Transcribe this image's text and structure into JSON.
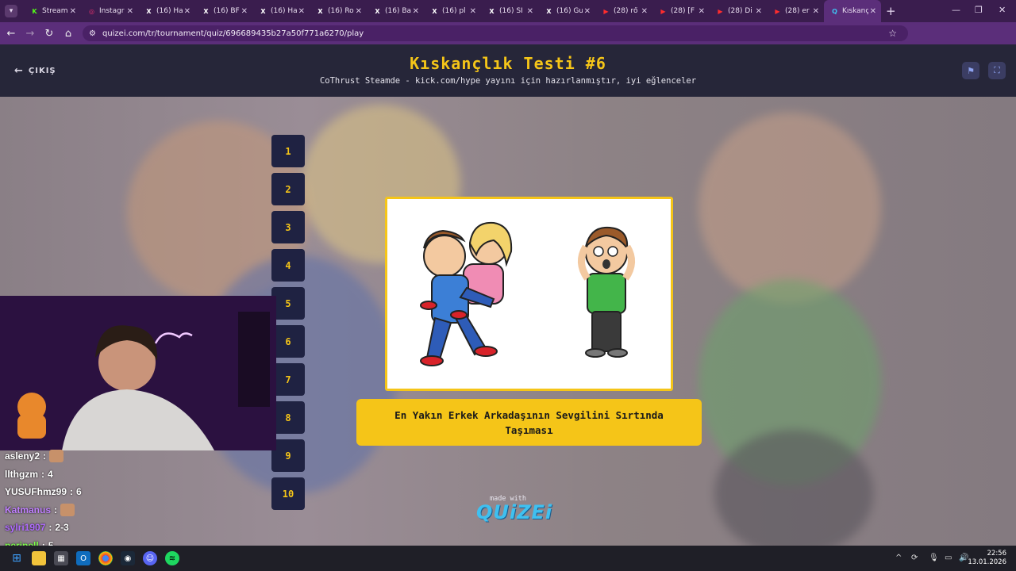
{
  "browser": {
    "tabs": [
      {
        "label": "Stream",
        "fav": "K",
        "fav_color": "#53fc18"
      },
      {
        "label": "Instagr",
        "fav": "◎",
        "fav_color": "#e1306c"
      },
      {
        "label": "(16) Ha",
        "fav": "X",
        "fav_color": "#ffffff"
      },
      {
        "label": "(16) BF",
        "fav": "X",
        "fav_color": "#ffffff"
      },
      {
        "label": "(16) Ha",
        "fav": "X",
        "fav_color": "#ffffff"
      },
      {
        "label": "(16) Ro",
        "fav": "X",
        "fav_color": "#ffffff"
      },
      {
        "label": "(16) Ba",
        "fav": "X",
        "fav_color": "#ffffff"
      },
      {
        "label": "(16) pl",
        "fav": "X",
        "fav_color": "#ffffff"
      },
      {
        "label": "(16) SI",
        "fav": "X",
        "fav_color": "#ffffff"
      },
      {
        "label": "(16) Gu",
        "fav": "X",
        "fav_color": "#ffffff"
      },
      {
        "label": "(28) rő",
        "fav": "▶",
        "fav_color": "#ff2d2d"
      },
      {
        "label": "(28) [F",
        "fav": "▶",
        "fav_color": "#ff2d2d"
      },
      {
        "label": "(28) Di",
        "fav": "▶",
        "fav_color": "#ff2d2d"
      },
      {
        "label": "(28) er",
        "fav": "▶",
        "fav_color": "#ff2d2d"
      },
      {
        "label": "Kıskanç",
        "fav": "Q",
        "fav_color": "#3fc0f0"
      }
    ],
    "url": "quizei.com/tr/tournament/quiz/696689435b27a50f771a6270/play"
  },
  "quiz": {
    "exit_label": "ÇIKIŞ",
    "title": "Kıskançlık Testi #6",
    "subtitle": "CoThrust Steamde - kick.com/hype yayını için hazırlanmıştır, iyi eğlenceler",
    "numbers": [
      "1",
      "2",
      "3",
      "4",
      "5",
      "6",
      "7",
      "8",
      "9",
      "10"
    ],
    "caption": "En Yakın Erkek Arkadaşının Sevgilini Sırtında Taşıması",
    "made_with": "made with",
    "logo": "QUiZEi"
  },
  "chat": [
    {
      "user": "asleny2",
      "msg": "",
      "color": "#ffffff",
      "icon": "emote"
    },
    {
      "user": "llthgzm",
      "msg": "4",
      "color": "#ffffff",
      "icon": ""
    },
    {
      "user": "YUSUFhmz99",
      "msg": "6",
      "color": "#ffffff",
      "icon": ""
    },
    {
      "user": "Katmanus",
      "msg": "",
      "color": "#c080ff",
      "icon": "emote"
    },
    {
      "user": "sylri1907",
      "msg": "2-3",
      "color": "#b06cff",
      "icon": ""
    },
    {
      "user": "peripell",
      "msg": "5",
      "color": "#7dff4a",
      "icon": ""
    }
  ],
  "stream_overlay": {
    "neon_text": "katman"
  },
  "system": {
    "time": "22:56",
    "date": "13.01.2026"
  }
}
